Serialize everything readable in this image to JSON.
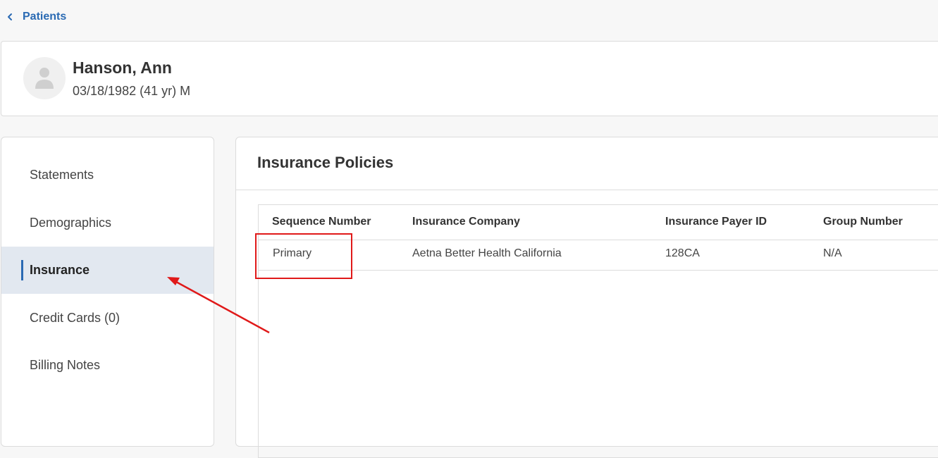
{
  "nav": {
    "back_label": "Patients"
  },
  "patient": {
    "name": "Hanson, Ann",
    "details": "03/18/1982 (41 yr) M"
  },
  "sidebar": {
    "items": [
      {
        "label": "Statements",
        "active": false
      },
      {
        "label": "Demographics",
        "active": false
      },
      {
        "label": "Insurance",
        "active": true
      },
      {
        "label": "Credit Cards (0)",
        "active": false
      },
      {
        "label": "Billing Notes",
        "active": false
      }
    ]
  },
  "insurance": {
    "title": "Insurance Policies",
    "columns": [
      "Sequence Number",
      "Insurance Company",
      "Insurance Payer ID",
      "Group Number"
    ],
    "rows": [
      {
        "sequence": "Primary",
        "company": "Aetna Better Health California",
        "payer_id": "128CA",
        "group": "N/A"
      }
    ]
  },
  "colors": {
    "accent": "#2a6ab3",
    "active_bg": "#e2e8f0",
    "annotation_red": "#e01919"
  },
  "icons": [
    "chevron-left-icon",
    "user-avatar-icon"
  ]
}
